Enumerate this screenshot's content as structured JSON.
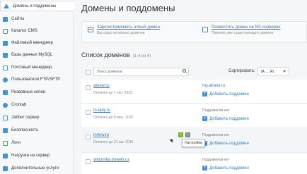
{
  "sidebar": {
    "items": [
      {
        "label": "Домены и поддомены",
        "icon": "home-icon",
        "active": true
      },
      {
        "label": "Сайты",
        "icon": "sites-icon"
      },
      {
        "label": "Каталог CMS",
        "icon": "cms-icon"
      },
      {
        "label": "Файловый менеджер",
        "icon": "file-manager-icon"
      },
      {
        "label": "Базы данных MySQL",
        "icon": "database-icon"
      },
      {
        "label": "Почтовый менеджер",
        "icon": "mail-icon"
      },
      {
        "label": "Пользователи FTP/SFTP",
        "icon": "ftp-icon"
      },
      {
        "label": "Резервные копии",
        "icon": "backup-icon"
      },
      {
        "label": "Crontab",
        "icon": "crontab-icon"
      },
      {
        "label": "Jabber сервер",
        "icon": "jabber-icon"
      },
      {
        "label": "Безопасность",
        "icon": "security-icon"
      },
      {
        "label": "Логи",
        "icon": "logs-icon"
      },
      {
        "label": "Нагрузка на сервер",
        "icon": "load-icon"
      },
      {
        "label": "Дополнительные услуги",
        "icon": "services-icon"
      }
    ]
  },
  "main": {
    "title": "Домены и поддомены",
    "actions": [
      {
        "link": "Зарегистрировать новый домен",
        "desc": "Вы сразу несколько доменов",
        "icon": "register-domain-icon"
      },
      {
        "link": "Разместить домен на NS серверах",
        "desc": "Перенос уже существующего домена",
        "icon": "transfer-domain-icon"
      }
    ],
    "list_title": "Список доменов",
    "list_count": "(1-4 из 4)",
    "search": {
      "placeholder": "Поиск доменов"
    },
    "sort": {
      "label": "Сортировать:",
      "value": "(А → Я)"
    },
    "domains": [
      {
        "name": "atnew.ru",
        "date": "Оплачен до 7 сен. 2015",
        "sub": "my.atnew.ru",
        "sub_is_link": true,
        "add": "Добавить поддомен"
      },
      {
        "name": "in-lady.ru",
        "date": "Оплачен до 8 июн. 2015",
        "sub": "Поддоменов нет",
        "sub_is_link": false,
        "add": "Добавить поддомен"
      },
      {
        "name": "innew.ru",
        "date": "Оплачен до 21 авг. 2015",
        "sub": "Поддоменов нет",
        "sub_is_link": false,
        "add": "Добавить поддомен"
      },
      {
        "name": "viktorrika.tmweb.ru",
        "date": "",
        "sub": "Поддоменов нет",
        "sub_is_link": false,
        "add": "Добавить поддомен"
      }
    ],
    "tooltip": "Настройка"
  },
  "colors": {
    "accent": "#4d8fcf",
    "link": "#3a78b5",
    "edit": "#8cc04a"
  }
}
